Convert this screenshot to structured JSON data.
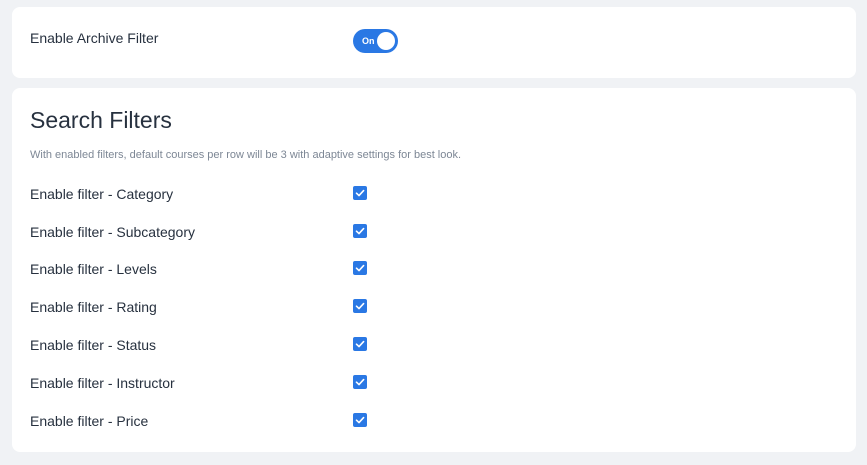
{
  "archive": {
    "label": "Enable Archive Filter",
    "toggle_text": "On",
    "toggle_state": "on"
  },
  "search_filters": {
    "title": "Search Filters",
    "description": "With enabled filters, default courses per row will be 3 with adaptive settings for best look.",
    "filters": [
      {
        "label": "Enable filter - Category",
        "checked": true
      },
      {
        "label": "Enable filter - Subcategory",
        "checked": true
      },
      {
        "label": "Enable filter - Levels",
        "checked": true
      },
      {
        "label": "Enable filter - Rating",
        "checked": true
      },
      {
        "label": "Enable filter - Status",
        "checked": true
      },
      {
        "label": "Enable filter - Instructor",
        "checked": true
      },
      {
        "label": "Enable filter - Price",
        "checked": true
      }
    ]
  },
  "colors": {
    "accent": "#2a78e4",
    "page_background": "#f0f2f5",
    "card_background": "#ffffff",
    "text": "#27313f",
    "muted_text": "#7d8795"
  },
  "icons": {
    "checkbox_check": "check-icon",
    "toggle_knob": "toggle-knob"
  }
}
